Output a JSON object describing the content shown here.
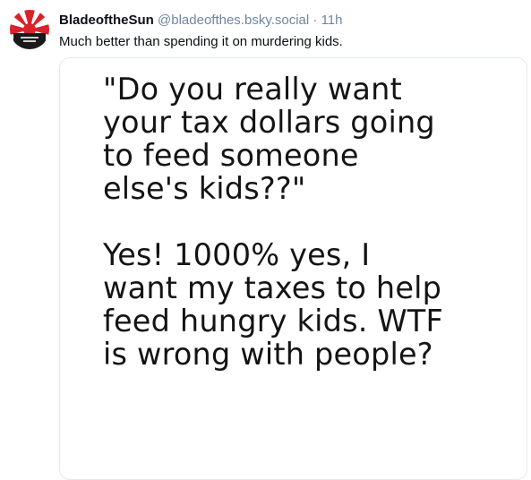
{
  "post": {
    "author_name": "BladeoftheSun",
    "author_handle": "@bladeofthes.bsky.social",
    "separator": "·",
    "timestamp": "11h",
    "text": "Much better than spending it on murdering kids."
  },
  "image": {
    "quote_lines": [
      "\"Do you really want",
      "your tax dollars going",
      "to feed someone",
      "else's kids??\""
    ],
    "reply_lines": [
      "Yes! 1000% yes, I",
      "want my taxes to help",
      "feed hungry kids. WTF",
      "is wrong with people?"
    ]
  },
  "colors": {
    "name": "#0b0f14",
    "muted": "#6f869f",
    "avatar_red": "#d9222a",
    "avatar_dark": "#1a1a1a"
  },
  "avatar": {
    "icon": "rising-sun-logo"
  }
}
